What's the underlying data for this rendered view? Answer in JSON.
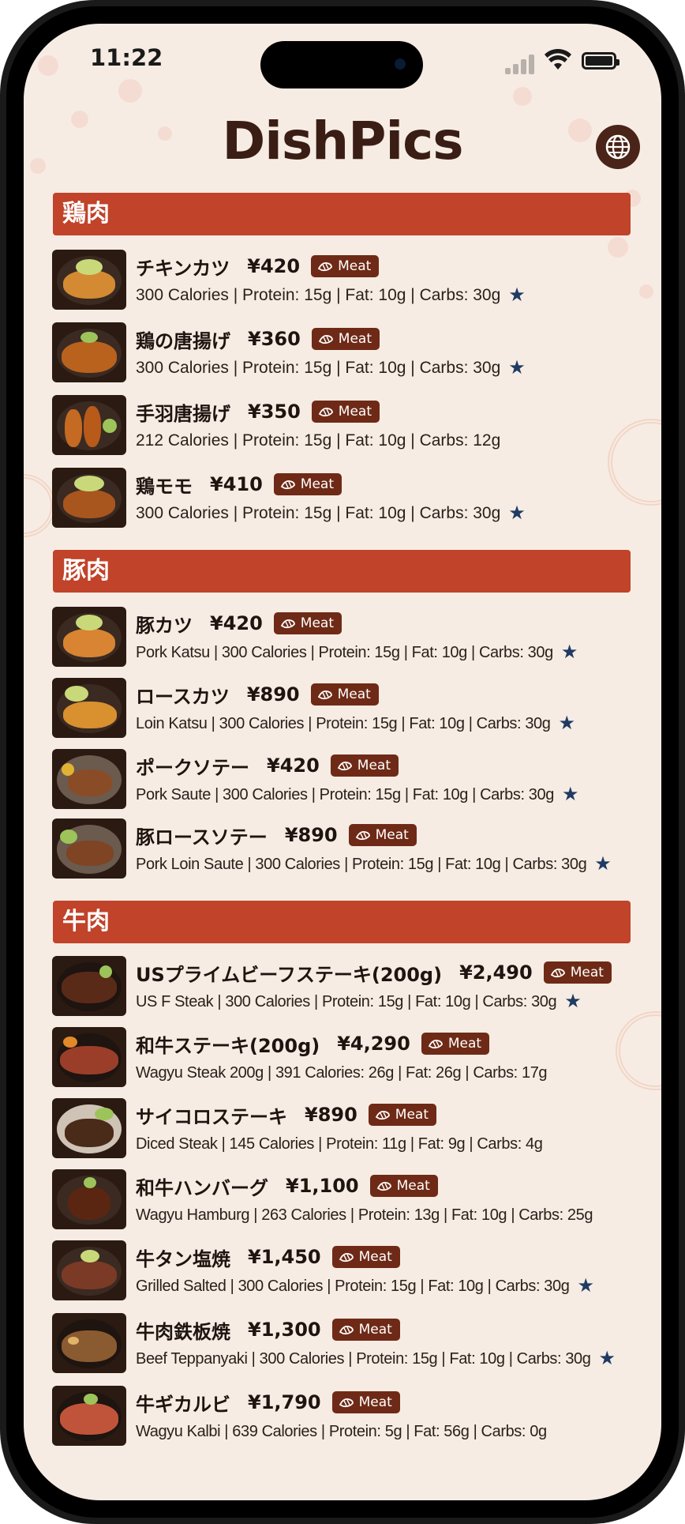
{
  "status": {
    "time": "11:22"
  },
  "app": {
    "title": "DishPics"
  },
  "sections": [
    {
      "title": "鶏肉",
      "items": [
        {
          "name": "チキンカツ",
          "price": "¥420",
          "badge": "Meat",
          "desc": "300 Calories | Protein: 15g | Fat: 10g | Carbs: 30g",
          "starred": true
        },
        {
          "name": "鶏の唐揚げ",
          "price": "¥360",
          "badge": "Meat",
          "desc": "300 Calories | Protein: 15g | Fat: 10g | Carbs: 30g",
          "starred": true
        },
        {
          "name": "手羽唐揚げ",
          "price": "¥350",
          "badge": "Meat",
          "desc": "212 Calories | Protein: 15g | Fat: 10g | Carbs: 12g",
          "starred": false
        },
        {
          "name": "鶏モモ",
          "price": "¥410",
          "badge": "Meat",
          "desc": "300 Calories | Protein: 15g | Fat: 10g | Carbs: 30g",
          "starred": true
        }
      ]
    },
    {
      "title": "豚肉",
      "items": [
        {
          "name": "豚カツ",
          "price": "¥420",
          "badge": "Meat",
          "desc": "Pork Katsu | 300 Calories | Protein: 15g | Fat: 10g | Carbs: 30g",
          "starred": true
        },
        {
          "name": "ロースカツ",
          "price": "¥890",
          "badge": "Meat",
          "desc": "Loin Katsu | 300 Calories | Protein: 15g | Fat: 10g | Carbs: 30g",
          "starred": true
        },
        {
          "name": "ポークソテー",
          "price": "¥420",
          "badge": "Meat",
          "desc": "Pork Saute | 300 Calories | Protein: 15g | Fat: 10g | Carbs: 30g",
          "starred": true
        },
        {
          "name": "豚ロースソテー",
          "price": "¥890",
          "badge": "Meat",
          "desc": "Pork Loin Saute | 300 Calories | Protein: 15g | Fat: 10g | Carbs: 30g",
          "starred": true
        }
      ]
    },
    {
      "title": "牛肉",
      "items": [
        {
          "name": "USプライムビーフステーキ(200g)",
          "price": "¥2,490",
          "badge": "Meat",
          "desc": "US F Steak | 300 Calories | Protein: 15g | Fat: 10g | Carbs: 30g",
          "starred": true
        },
        {
          "name": "和牛ステーキ(200g)",
          "price": "¥4,290",
          "badge": "Meat",
          "desc": "Wagyu Steak 200g | 391 Calories: 26g | Fat: 26g | Carbs: 17g",
          "starred": false
        },
        {
          "name": "サイコロステーキ",
          "price": "¥890",
          "badge": "Meat",
          "desc": "Diced Steak | 145 Calories | Protein: 11g | Fat: 9g | Carbs: 4g",
          "starred": false
        },
        {
          "name": "和牛ハンバーグ",
          "price": "¥1,100",
          "badge": "Meat",
          "desc": "Wagyu Hamburg | 263 Calories | Protein: 13g | Fat: 10g | Carbs: 25g",
          "starred": false
        },
        {
          "name": "牛タン塩焼",
          "price": "¥1,450",
          "badge": "Meat",
          "desc": "Grilled Salted | 300 Calories | Protein: 15g | Fat: 10g | Carbs: 30g",
          "starred": true
        },
        {
          "name": "牛肉鉄板焼",
          "price": "¥1,300",
          "badge": "Meat",
          "desc": "Beef Teppanyaki | 300 Calories | Protein: 15g | Fat: 10g | Carbs: 30g",
          "starred": true
        },
        {
          "name": "牛ギカルビ",
          "price": "¥1,790",
          "badge": "Meat",
          "desc": "Wagyu Kalbi | 639 Calories | Protein: 5g | Fat: 56g | Carbs: 0g",
          "starred": false
        }
      ]
    }
  ],
  "icons": {
    "globe": "globe-icon",
    "badge": "meat-icon",
    "star": "star-icon"
  },
  "colors": {
    "section_header": "#c0432a",
    "badge": "#6e2a16",
    "star": "#1f3b63",
    "background": "#f6ece3",
    "title": "#3a1d14"
  }
}
